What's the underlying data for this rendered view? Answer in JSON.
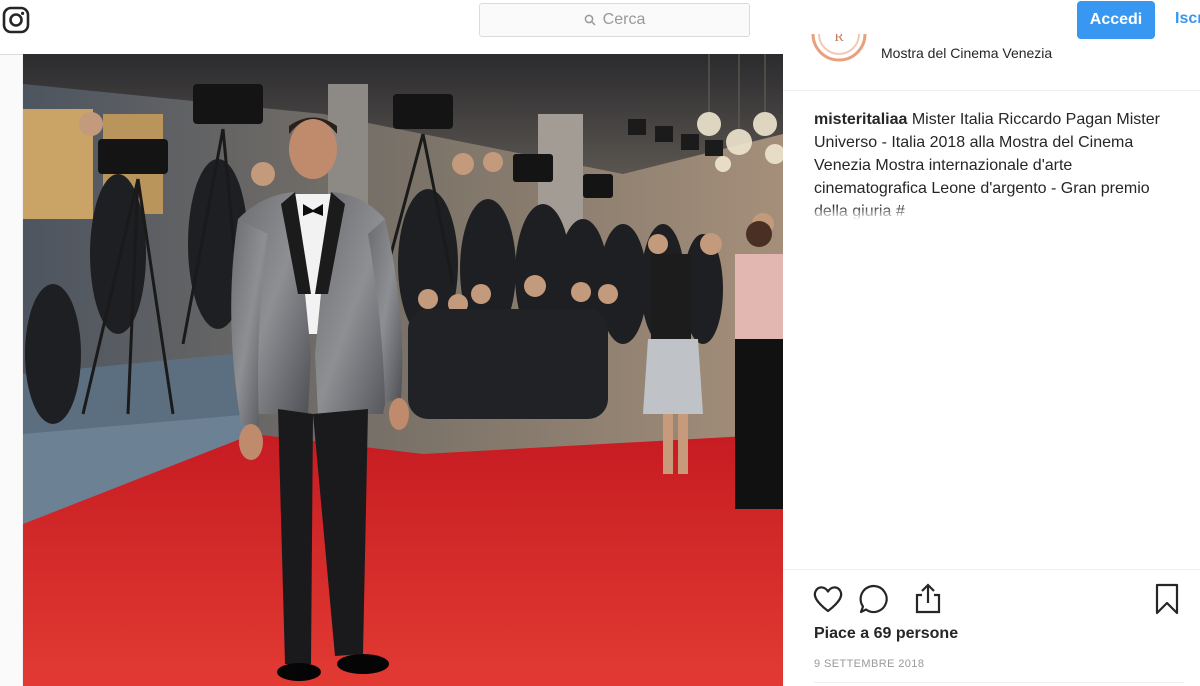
{
  "search": {
    "placeholder": "Cerca"
  },
  "nav": {
    "login_label": "Accedi",
    "signup_label": "Iscriviti"
  },
  "post": {
    "location": "Mostra del Cinema Venezia",
    "username": "misteritaliaa",
    "caption": "Mister Italia Riccardo Pagan Mister Universo - Italia 2018 alla Mostra del Cinema Venezia Mostra internazionale d'arte cinematografica Leone d'argento - Gran premio della giuria #",
    "likes_text": "Piace a 69 persone",
    "date": "9 SETTEMBRE 2018"
  },
  "icons": [
    "instagram-logo-icon",
    "search-icon",
    "heart-icon",
    "comment-icon",
    "share-icon",
    "bookmark-icon"
  ],
  "colors": {
    "accent": "#3897f0",
    "text": "#262626",
    "muted": "#999999",
    "carpet": "#d8232a"
  }
}
